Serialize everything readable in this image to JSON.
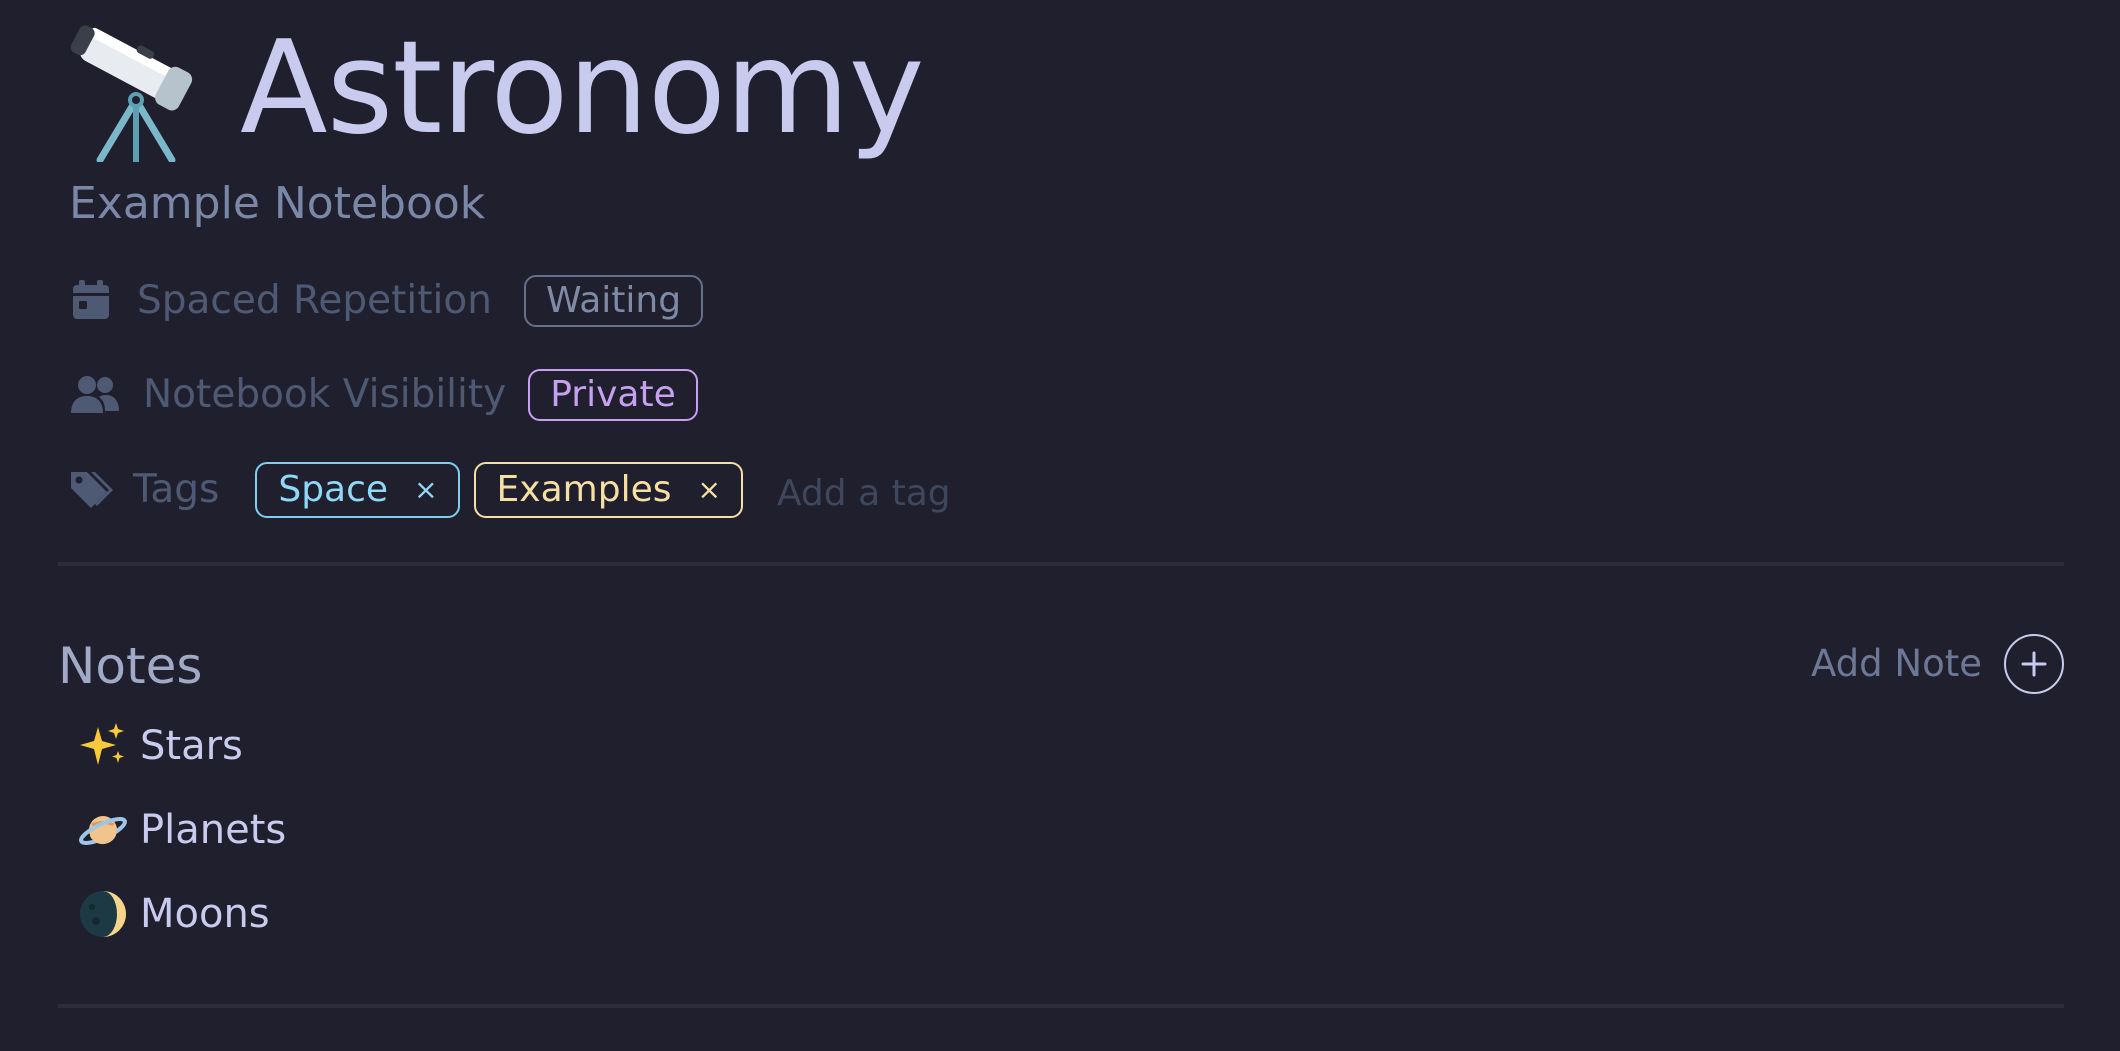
{
  "notebook": {
    "icon": "telescope-icon",
    "title": "Astronomy",
    "subtitle": "Example Notebook"
  },
  "properties": {
    "spaced_repetition": {
      "icon": "calendar-icon",
      "label": "Spaced Repetition",
      "status": "Waiting"
    },
    "visibility": {
      "icon": "users-icon",
      "label": "Notebook Visibility",
      "status": "Private"
    },
    "tags": {
      "icon": "tags-icon",
      "label": "Tags",
      "items": [
        {
          "label": "Space",
          "color": "#8fd8f6",
          "remove": "×"
        },
        {
          "label": "Examples",
          "color": "#f5dfa3",
          "remove": "×"
        }
      ],
      "input_placeholder": "Add a tag"
    }
  },
  "notes": {
    "heading": "Notes",
    "add_label": "Add Note",
    "items": [
      {
        "icon": "sparkles-icon",
        "title": "Stars"
      },
      {
        "icon": "ringed-planet-icon",
        "title": "Planets"
      },
      {
        "icon": "crescent-moon-icon",
        "title": "Moons"
      }
    ]
  },
  "colors": {
    "background": "#1f1f2e",
    "title": "#c8cbed",
    "muted": "#4e5a73",
    "private_accent": "#c7a1f0"
  }
}
